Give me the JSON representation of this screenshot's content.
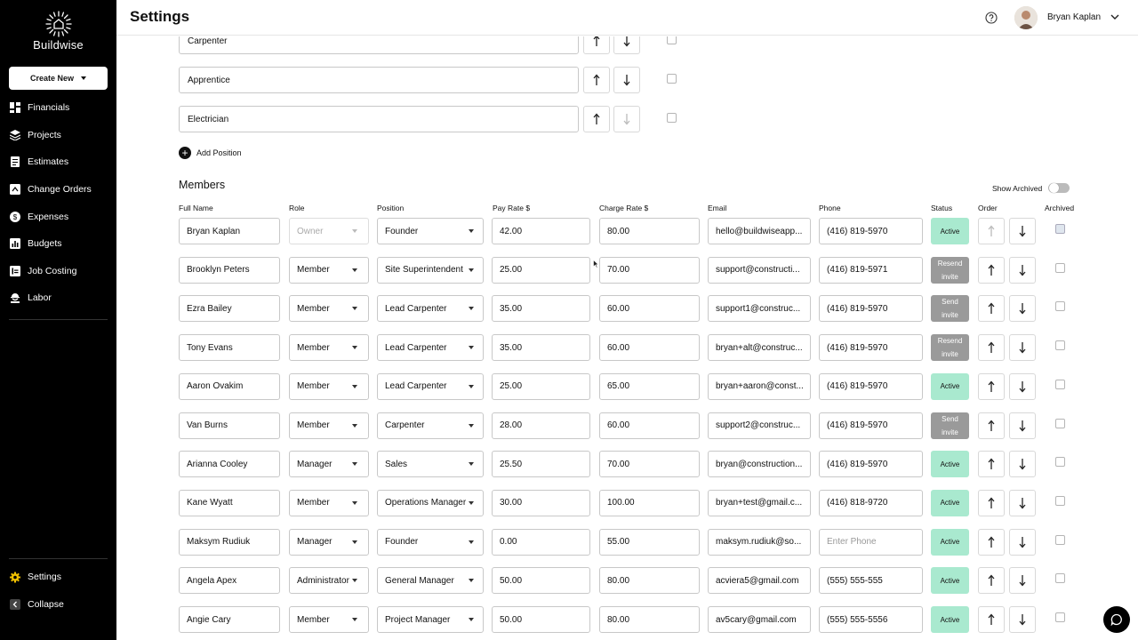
{
  "app": {
    "logo_text": "Buildwise",
    "page_title": "Settings",
    "user_name": "Bryan Kaplan"
  },
  "sidebar": {
    "create_label": "Create New",
    "items": [
      {
        "label": "Financials",
        "icon": "dashboard-icon"
      },
      {
        "label": "Projects",
        "icon": "layers-icon"
      },
      {
        "label": "Estimates",
        "icon": "document-icon"
      },
      {
        "label": "Change Orders",
        "icon": "change-orders-icon"
      },
      {
        "label": "Expenses",
        "icon": "expenses-icon"
      },
      {
        "label": "Budgets",
        "icon": "chart-icon"
      },
      {
        "label": "Job Costing",
        "icon": "job-costing-icon"
      },
      {
        "label": "Labor",
        "icon": "worker-icon"
      }
    ],
    "settings_label": "Settings",
    "collapse_label": "Collapse"
  },
  "positions": [
    "Carpenter",
    "Apprentice",
    "Electrician"
  ],
  "add_position_label": "Add Position",
  "members": {
    "title": "Members",
    "show_archived_label": "Show Archived",
    "columns": [
      "Full Name",
      "Role",
      "Position",
      "Pay Rate $",
      "Charge Rate $",
      "Email",
      "Phone",
      "Status",
      "Order",
      "Archived"
    ],
    "phone_placeholder": "Enter Phone",
    "rows": [
      {
        "name": "Bryan Kaplan",
        "role": "Owner",
        "position": "Founder",
        "pay": "42.00",
        "charge": "80.00",
        "email": "hello@buildwiseapp...",
        "phone": "(416) 819-5970",
        "status": "Active"
      },
      {
        "name": "Brooklyn Peters",
        "role": "Member",
        "position": "Site Superintendent",
        "pay": "25.00",
        "charge": "70.00",
        "email": "support@constructi...",
        "phone": "(416) 819-5971",
        "status": "Resend invite"
      },
      {
        "name": "Ezra Bailey",
        "role": "Member",
        "position": "Lead Carpenter",
        "pay": "35.00",
        "charge": "60.00",
        "email": "support1@construc...",
        "phone": "(416) 819-5970",
        "status": "Send invite"
      },
      {
        "name": "Tony Evans",
        "role": "Member",
        "position": "Lead Carpenter",
        "pay": "35.00",
        "charge": "60.00",
        "email": "bryan+alt@construc...",
        "phone": "(416) 819-5970",
        "status": "Resend invite"
      },
      {
        "name": "Aaron Ovakim",
        "role": "Member",
        "position": "Lead Carpenter",
        "pay": "25.00",
        "charge": "65.00",
        "email": "bryan+aaron@const...",
        "phone": "(416) 819-5970",
        "status": "Active"
      },
      {
        "name": "Van Burns",
        "role": "Member",
        "position": "Carpenter",
        "pay": "28.00",
        "charge": "60.00",
        "email": "support2@construc...",
        "phone": "(416) 819-5970",
        "status": "Send invite"
      },
      {
        "name": "Arianna Cooley",
        "role": "Manager",
        "position": "Sales",
        "pay": "25.50",
        "charge": "70.00",
        "email": "bryan@construction...",
        "phone": "(416) 819-5970",
        "status": "Active"
      },
      {
        "name": "Kane Wyatt",
        "role": "Member",
        "position": "Operations Manager",
        "pay": "30.00",
        "charge": "100.00",
        "email": "bryan+test@gmail.c...",
        "phone": "(416) 818-9720",
        "status": "Active"
      },
      {
        "name": "Maksym Rudiuk",
        "role": "Manager",
        "position": "Founder",
        "pay": "0.00",
        "charge": "55.00",
        "email": "maksym.rudiuk@so...",
        "phone": "",
        "status": "Active"
      },
      {
        "name": "Angela Apex",
        "role": "Administrator",
        "position": "General Manager",
        "pay": "50.00",
        "charge": "80.00",
        "email": "acviera5@gmail.com",
        "phone": "(555) 555-555",
        "status": "Active"
      },
      {
        "name": "Angie Cary",
        "role": "Member",
        "position": "Project Manager",
        "pay": "50.00",
        "charge": "80.00",
        "email": "av5cary@gmail.com",
        "phone": "(555) 555-5556",
        "status": "Active"
      }
    ]
  },
  "colors": {
    "active_status": "#a9e9cf",
    "invite_status": "#9a9a9a",
    "sidebar_bg": "#000000",
    "settings_icon": "#f0c000"
  }
}
